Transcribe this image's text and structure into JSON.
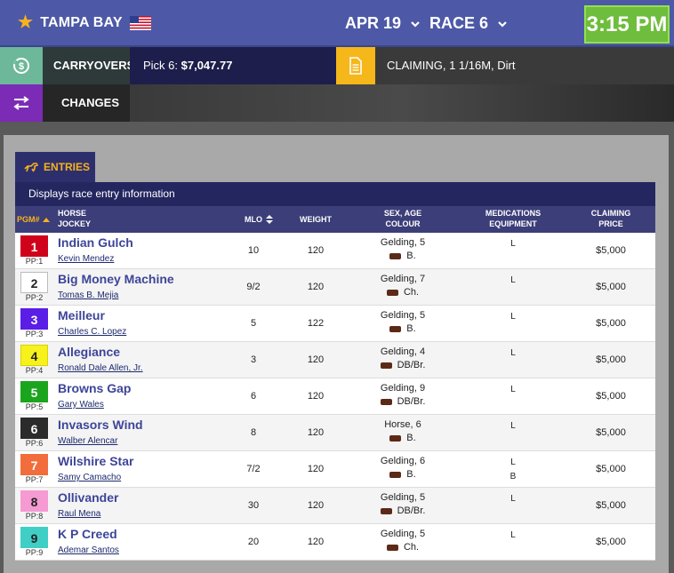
{
  "header": {
    "track": "TAMPA BAY",
    "date": "APR 19",
    "race": "RACE 6",
    "post_time": "3:15 PM",
    "colors": {
      "bar": "#4d59a6",
      "clock": "#6ebd3c",
      "star": "#f7b21e"
    }
  },
  "info": {
    "carryovers_label": "CARRYOVERS",
    "pick6_prefix": "Pick 6: ",
    "pick6_amount": "$7,047.77",
    "race_conditions": "CLAIMING, 1 1/16M, Dirt",
    "changes_label": "CHANGES"
  },
  "entries": {
    "tab_label": "ENTRIES",
    "description": "Displays race entry information",
    "columns": {
      "pgm": "PGM#",
      "horse": "HORSE",
      "jockey": "JOCKEY",
      "mlo": "MLO",
      "weight": "WEIGHT",
      "sex_age": "SEX, AGE",
      "colour": "COLOUR",
      "medications": "MEDICATIONS",
      "equipment": "EQUIPMENT",
      "claiming": "CLAIMING",
      "price": "PRICE"
    },
    "rows": [
      {
        "pgm": "1",
        "pp": "PP:1",
        "horse": "Indian Gulch",
        "jockey": "Kevin Mendez",
        "mlo": "10",
        "weight": "120",
        "sex_age": "Gelding, 5",
        "colour": "B.",
        "med": "L",
        "equip": "",
        "price": "$5,000",
        "saddle_bg": "#d0021b",
        "saddle_fg": "#ffffff",
        "saddle_border": "#d0021b"
      },
      {
        "pgm": "2",
        "pp": "PP:2",
        "horse": "Big Money Machine",
        "jockey": "Tomas B. Mejia",
        "mlo": "9/2",
        "weight": "120",
        "sex_age": "Gelding, 7",
        "colour": "Ch.",
        "med": "L",
        "equip": "",
        "price": "$5,000",
        "saddle_bg": "#ffffff",
        "saddle_fg": "#222222",
        "saddle_border": "#bbbbbb"
      },
      {
        "pgm": "3",
        "pp": "PP:3",
        "horse": "Meilleur",
        "jockey": "Charles C. Lopez",
        "mlo": "5",
        "weight": "122",
        "sex_age": "Gelding, 5",
        "colour": "B.",
        "med": "L",
        "equip": "",
        "price": "$5,000",
        "saddle_bg": "#5a1ee6",
        "saddle_fg": "#ffffff",
        "saddle_border": "#5a1ee6"
      },
      {
        "pgm": "4",
        "pp": "PP:4",
        "horse": "Allegiance",
        "jockey": "Ronald Dale Allen, Jr.",
        "mlo": "3",
        "weight": "120",
        "sex_age": "Gelding, 4",
        "colour": "DB/Br.",
        "med": "L",
        "equip": "",
        "price": "$5,000",
        "saddle_bg": "#f8f21c",
        "saddle_fg": "#222222",
        "saddle_border": "#d8d200"
      },
      {
        "pgm": "5",
        "pp": "PP:5",
        "horse": "Browns Gap",
        "jockey": "Gary Wales",
        "mlo": "6",
        "weight": "120",
        "sex_age": "Gelding, 9",
        "colour": "DB/Br.",
        "med": "L",
        "equip": "",
        "price": "$5,000",
        "saddle_bg": "#1aa51d",
        "saddle_fg": "#ffffff",
        "saddle_border": "#1aa51d"
      },
      {
        "pgm": "6",
        "pp": "PP:6",
        "horse": "Invasors Wind",
        "jockey": "Walber Alencar",
        "mlo": "8",
        "weight": "120",
        "sex_age": "Horse, 6",
        "colour": "B.",
        "med": "L",
        "equip": "",
        "price": "$5,000",
        "saddle_bg": "#2b2b2b",
        "saddle_fg": "#ffffff",
        "saddle_border": "#2b2b2b"
      },
      {
        "pgm": "7",
        "pp": "PP:7",
        "horse": "Wilshire Star",
        "jockey": "Samy Camacho",
        "mlo": "7/2",
        "weight": "120",
        "sex_age": "Gelding, 6",
        "colour": "B.",
        "med": "L",
        "equip": "B",
        "price": "$5,000",
        "saddle_bg": "#f26d3b",
        "saddle_fg": "#ffffff",
        "saddle_border": "#f26d3b"
      },
      {
        "pgm": "8",
        "pp": "PP:8",
        "horse": "Ollivander",
        "jockey": "Raul Mena",
        "mlo": "30",
        "weight": "120",
        "sex_age": "Gelding, 5",
        "colour": "DB/Br.",
        "med": "L",
        "equip": "",
        "price": "$5,000",
        "saddle_bg": "#f59ad2",
        "saddle_fg": "#222222",
        "saddle_border": "#f59ad2"
      },
      {
        "pgm": "9",
        "pp": "PP:9",
        "horse": "K P Creed",
        "jockey": "Ademar Santos",
        "mlo": "20",
        "weight": "120",
        "sex_age": "Gelding, 5",
        "colour": "Ch.",
        "med": "L",
        "equip": "",
        "price": "$5,000",
        "saddle_bg": "#3fcfc6",
        "saddle_fg": "#222222",
        "saddle_border": "#3fcfc6"
      }
    ]
  }
}
